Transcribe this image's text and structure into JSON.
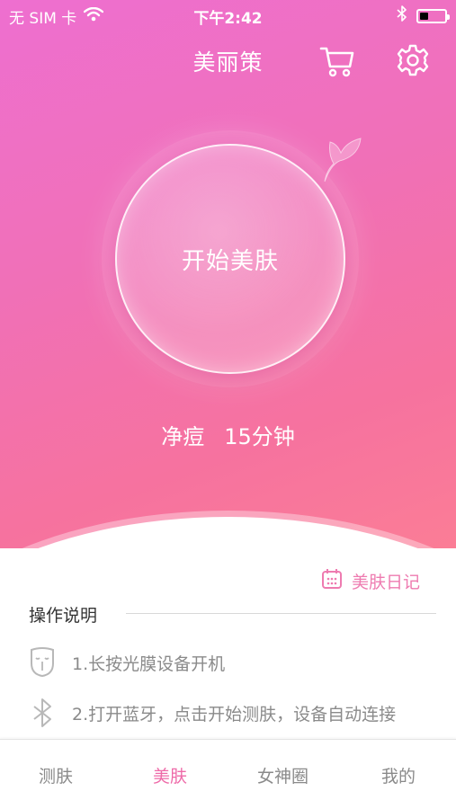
{
  "status_bar": {
    "carrier": "无 SIM 卡",
    "time": "下午2:42",
    "battery_level": 0.35
  },
  "header": {
    "title": "美丽策",
    "cart_icon": "shopping-cart-icon",
    "settings_icon": "gear-icon"
  },
  "main": {
    "start_button_label": "开始美肤",
    "mode": "净痘",
    "duration": "15分钟"
  },
  "content": {
    "diary_link": "美肤日记",
    "section_title": "操作说明",
    "steps": [
      {
        "icon": "face-mask-icon",
        "text": "1.长按光膜设备开机"
      },
      {
        "icon": "bluetooth-icon",
        "text": "2.打开蓝牙，点击开始测肤，设备自动连接"
      }
    ]
  },
  "tabs": [
    {
      "label": "测肤",
      "active": false
    },
    {
      "label": "美肤",
      "active": true
    },
    {
      "label": "女神圈",
      "active": false
    },
    {
      "label": "我的",
      "active": false
    }
  ],
  "colors": {
    "accent": "#ee6aa8",
    "gradient_start": "#ee6fd0",
    "gradient_end": "#fb7d96"
  }
}
